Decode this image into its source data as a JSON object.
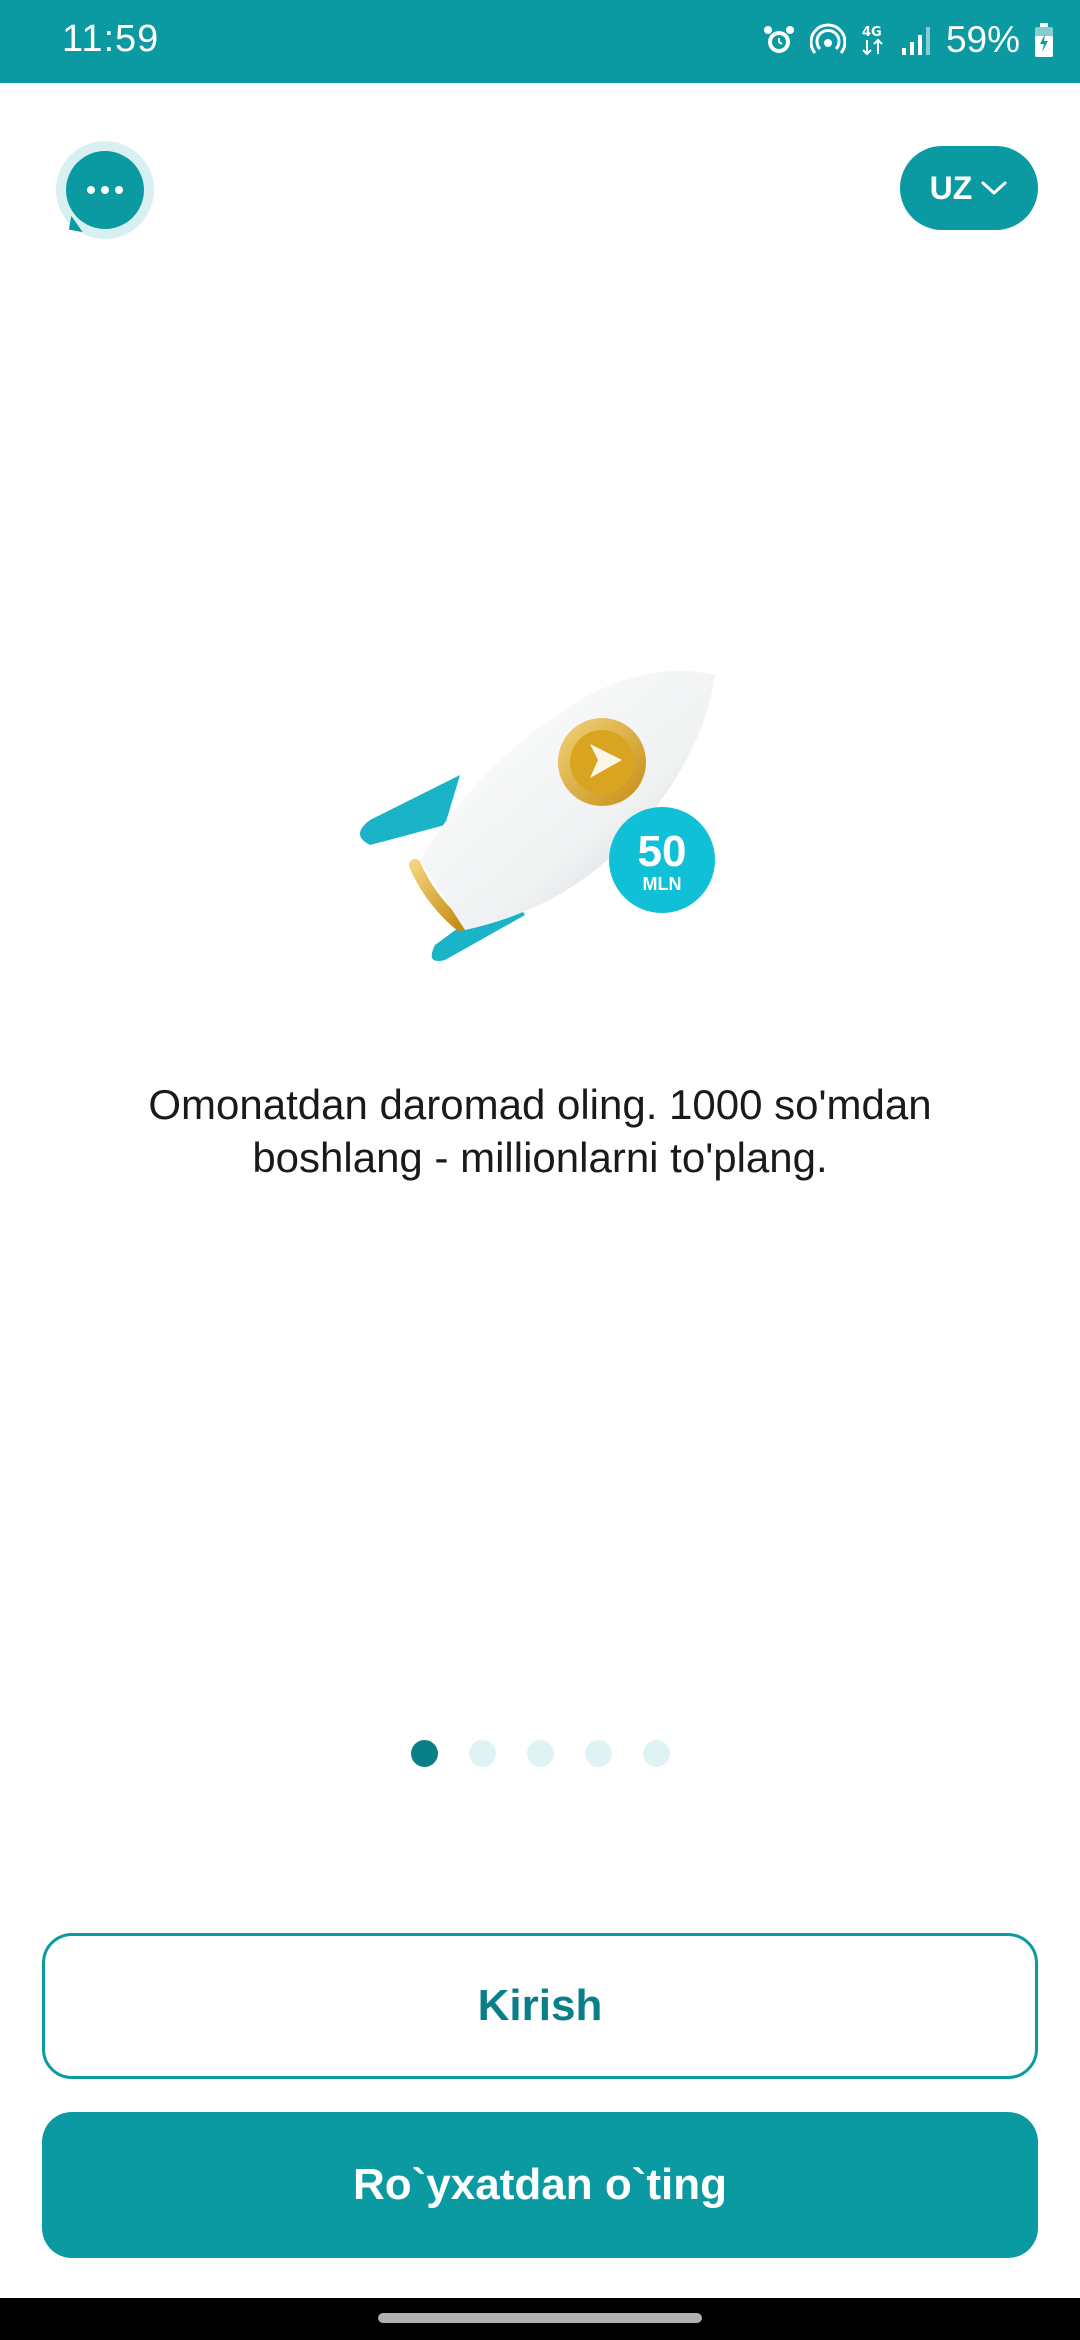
{
  "status_bar": {
    "time": "11:59",
    "battery": "59%",
    "icons": [
      "alarm-icon",
      "hotspot-icon",
      "network-4g-icon",
      "signal-icon",
      "battery-charging-icon"
    ],
    "background": "#0b9aa2"
  },
  "header": {
    "chat_icon": "chat-bubble-icon",
    "language": "UZ",
    "language_icon": "chevron-down-icon"
  },
  "slide": {
    "illustration": "rocket-icon",
    "badge_value": "50",
    "badge_unit": "MLN",
    "text": "Omonatdan daromad oling. 1000 so'mdan boshlang - millionlarni to'plang.",
    "total_slides": 5,
    "active_slide": 1
  },
  "actions": {
    "login_label": "Kirish",
    "register_label": "Ro`yxatdan o`ting"
  },
  "colors": {
    "accent": "#0b9aa2",
    "accent_dark": "#0b7f88",
    "dot_inactive": "#e0f3f4",
    "gold": "#d9a520",
    "rocket_teal": "#1ab3c7"
  }
}
